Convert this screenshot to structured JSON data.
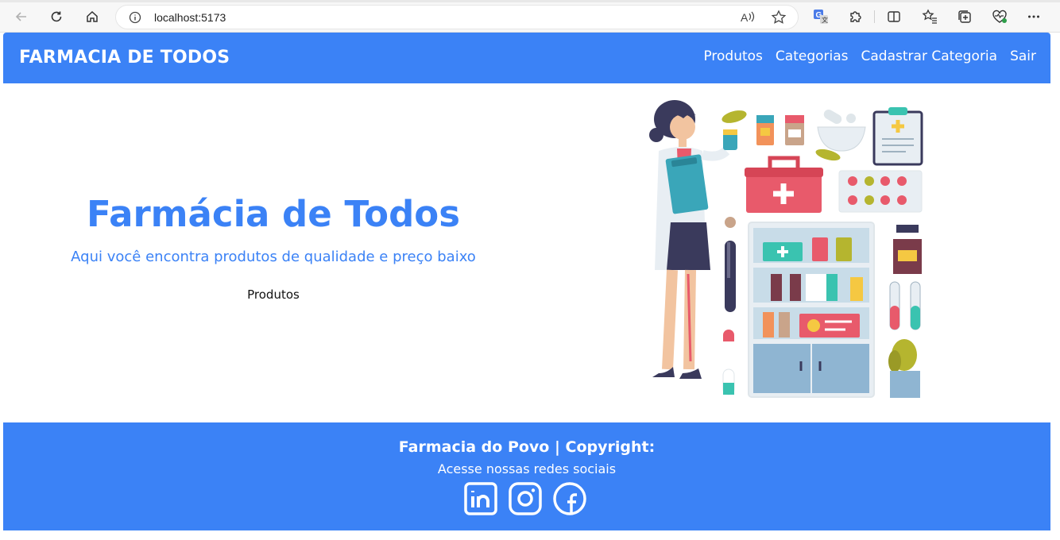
{
  "browser": {
    "url": "localhost:5173"
  },
  "navbar": {
    "brand": "FARMACIA DE TODOS",
    "links": [
      "Produtos",
      "Categorias",
      "Cadastrar Categoria",
      "Sair"
    ]
  },
  "hero": {
    "title": "Farmácia de Todos",
    "subtitle": "Aqui você encontra produtos de qualidade e preço baixo",
    "button": "Produtos"
  },
  "footer": {
    "title": "Farmacia do Povo | Copyright:",
    "subtitle": "Acesse nossas redes sociais",
    "socials": [
      "linkedin-icon",
      "instagram-icon",
      "facebook-icon"
    ]
  },
  "colors": {
    "primary": "#3b82f6",
    "white": "#ffffff"
  }
}
